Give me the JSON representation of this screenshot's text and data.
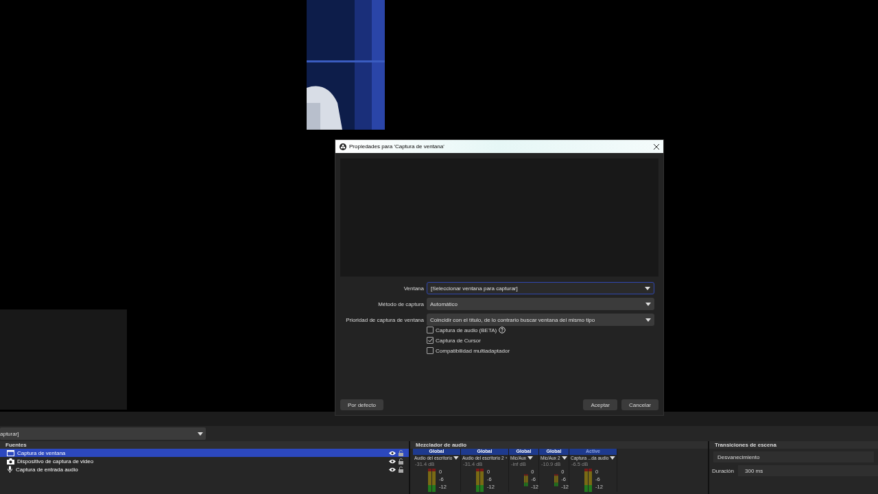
{
  "dialog": {
    "title": "Propiedades para 'Captura de ventana'",
    "fields": [
      {
        "label": "Ventana",
        "value": "[Seleccionar ventana para capturar]",
        "focused": true
      },
      {
        "label": "Método de captura",
        "value": "Automático",
        "focused": false
      },
      {
        "label": "Prioridad de captura de ventana",
        "value": "Coincidir con el título, de lo contrario buscar ventana del mismo tipo",
        "focused": false
      }
    ],
    "checkboxes": [
      {
        "label": "Captura de audio (BETA)",
        "checked": false,
        "help": true
      },
      {
        "label": "Captura de Cursor",
        "checked": true,
        "help": false
      },
      {
        "label": "Compatibilidad multiadaptador",
        "checked": false,
        "help": false
      }
    ],
    "default_button": "Por defecto",
    "buttons": [
      "Aceptar",
      "Cancelar"
    ]
  },
  "scene_dropdown": {
    "value": "apturar]"
  },
  "sources": {
    "title": "Fuentes",
    "items": [
      {
        "label": "Captura de ventana",
        "kind": "window",
        "selected": true
      },
      {
        "label": "Dispositivo de captura de video",
        "kind": "camera",
        "selected": false
      },
      {
        "label": "Captura de entrada audio",
        "kind": "mic",
        "selected": false
      }
    ]
  },
  "mixer": {
    "title": "Mezclador de audio",
    "channels": [
      {
        "mode": "Global",
        "dimmed": false,
        "name": "Audio del escritorio",
        "reading": "-31.4 dB",
        "ticks": [
          "0",
          "-6",
          "-12"
        ]
      },
      {
        "mode": "Global",
        "dimmed": false,
        "name": "Audio del escritorio 2",
        "reading": "-31.4 dB",
        "ticks": [
          "0",
          "-6",
          "-12"
        ]
      },
      {
        "mode": "Global",
        "dimmed": false,
        "name": "Mic/Aux",
        "reading": "-inf dB",
        "ticks": [
          "0",
          "-6",
          "-12"
        ]
      },
      {
        "mode": "Global",
        "dimmed": false,
        "name": "Mic/Aux 2",
        "reading": "-10.9 dB",
        "ticks": [
          "0",
          "-6",
          "-12"
        ]
      },
      {
        "mode": "Active",
        "dimmed": true,
        "name": "Captura ...da audio",
        "reading": "-6.5 dB",
        "ticks": [
          "0",
          "-6",
          "-12"
        ]
      }
    ]
  },
  "transitions": {
    "title": "Transiciones de escena",
    "transition": "Desvanecimiento",
    "duration_label": "Duración",
    "duration": "300 ms"
  }
}
